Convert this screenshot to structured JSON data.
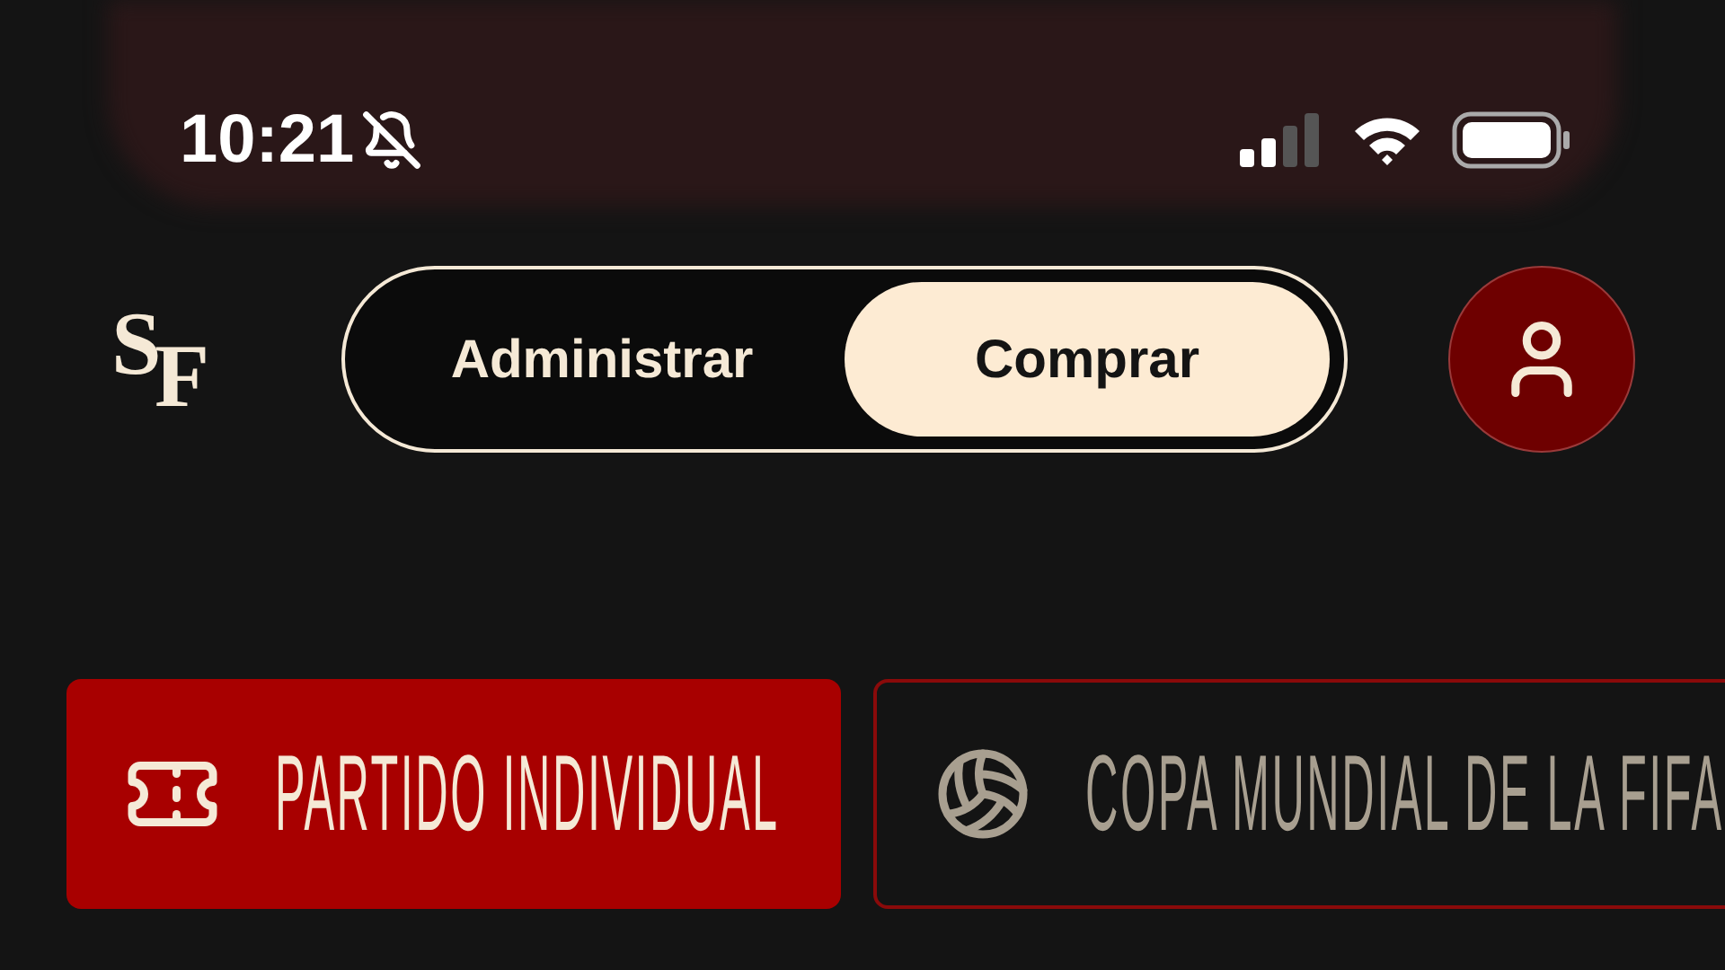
{
  "status_bar": {
    "time": "10:21",
    "silent": true
  },
  "header": {
    "logo": "SF",
    "toggle": [
      {
        "label": "Administrar",
        "selected": false
      },
      {
        "label": "Comprar",
        "selected": true
      }
    ]
  },
  "categories": [
    {
      "label": "PARTIDO INDIVIDUAL",
      "kind": "ticket",
      "selected": true
    },
    {
      "label": "COPA MUNDIAL DE LA FIFA",
      "kind": "ball",
      "selected": false
    }
  ]
}
